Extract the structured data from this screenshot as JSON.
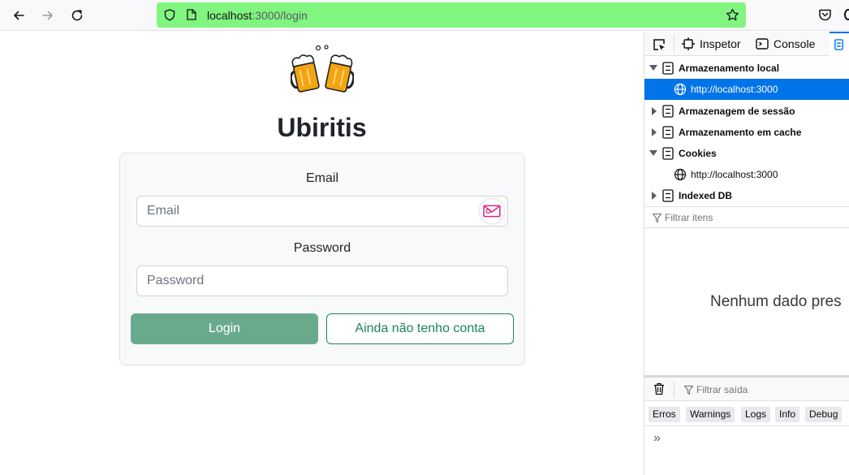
{
  "browser": {
    "url_host": "localhost",
    "url_path": ":3000/login",
    "icons": [
      "back-arrow-icon",
      "forward-arrow-icon",
      "reload-icon",
      "shield-icon",
      "page-icon",
      "star-icon",
      "pocket-icon"
    ]
  },
  "page": {
    "title": "Ubiritis",
    "email_label": "Email",
    "email_placeholder": "Email",
    "password_label": "Password",
    "password_placeholder": "Password",
    "login_button": "Login",
    "signup_button": "Ainda não tenho conta",
    "colors": {
      "primary": "#6aaa8c",
      "outline": "#198754"
    }
  },
  "devtools": {
    "tabs": [
      {
        "label": "Inspetor"
      },
      {
        "label": "Console"
      }
    ],
    "tree": [
      {
        "label": "Armazenamento local",
        "bold": true,
        "expanded": true
      },
      {
        "label": "http://localhost:3000",
        "bold": false,
        "selected": true
      },
      {
        "label": "Armazenagem de sessão",
        "bold": true,
        "expanded": false
      },
      {
        "label": "Armazenamento em cache",
        "bold": true,
        "expanded": false
      },
      {
        "label": "Cookies",
        "bold": true,
        "expanded": true
      },
      {
        "label": "http://localhost:3000",
        "bold": false,
        "selected": false
      },
      {
        "label": "Indexed DB",
        "bold": true,
        "expanded": false
      }
    ],
    "filter_placeholder": "Filtrar itens",
    "empty_message": "Nenhum dado pres",
    "console_filter_placeholder": "Filtrar saída",
    "levels": [
      "Erros",
      "Warnings",
      "Logs",
      "Info",
      "Debug"
    ],
    "prompt": "»",
    "accent": "#0074e8"
  }
}
